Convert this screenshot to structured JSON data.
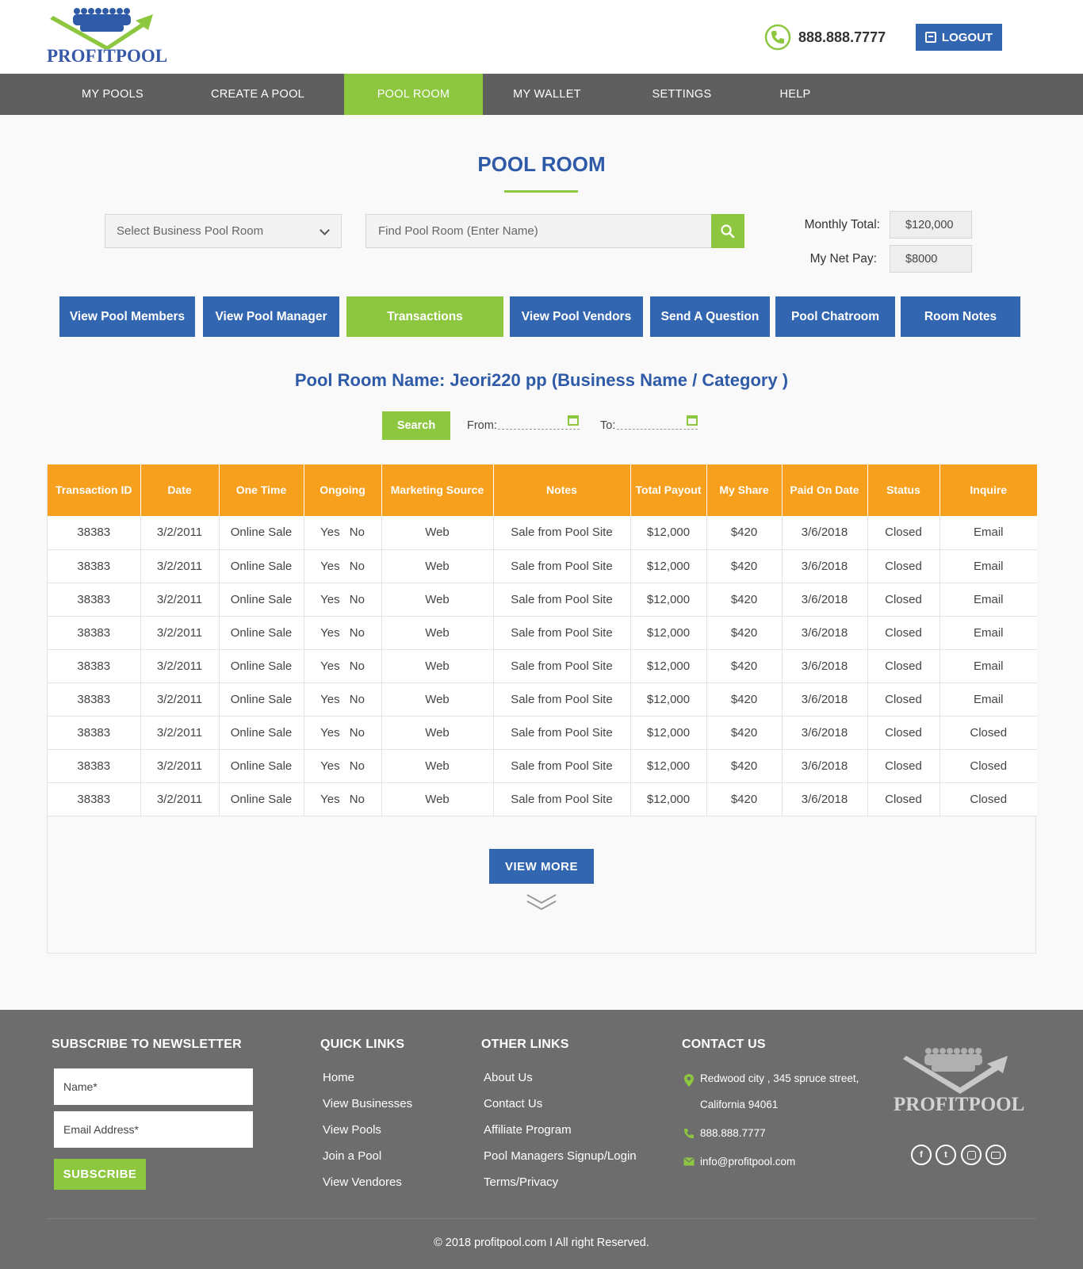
{
  "header": {
    "logo_text": "PROFITPOOL",
    "phone": "888.888.7777",
    "logout_label": "LOGOUT"
  },
  "nav": {
    "items": [
      {
        "label": "MY POOLS"
      },
      {
        "label": "CREATE A POOL"
      },
      {
        "label": "POOL ROOM"
      },
      {
        "label": "MY WALLET"
      },
      {
        "label": "SETTINGS"
      },
      {
        "label": "HELP"
      }
    ],
    "active": "POOL ROOM"
  },
  "page": {
    "title": "POOL ROOM",
    "select_placeholder": "Select Business Pool Room",
    "search_placeholder": "Find Pool Room (Enter Name)",
    "monthly_total_label": "Monthly Total:",
    "monthly_total_value": "$120,000",
    "net_pay_label": "My Net Pay:",
    "net_pay_value": "$8000"
  },
  "tabs": [
    {
      "label": "View Pool Members"
    },
    {
      "label": "View Pool Manager"
    },
    {
      "label": "Transactions"
    },
    {
      "label": "View Pool Vendors"
    },
    {
      "label": "Send A Question"
    },
    {
      "label": "Pool Chatroom"
    },
    {
      "label": "Room Notes"
    }
  ],
  "active_tab": "Transactions",
  "filter": {
    "room_name": "Pool Room Name: Jeori220 pp (Business Name / Category )",
    "search_label": "Search",
    "from_label": "From:",
    "to_label": "To:"
  },
  "table": {
    "headers": [
      "Transaction ID",
      "Date",
      "One Time",
      "Ongoing",
      "Marketing Source",
      "Notes",
      "Total Payout",
      "My Share",
      "Paid On Date",
      "Status",
      "Inquire"
    ],
    "rows": [
      [
        "38383",
        "3/2/2011",
        "Online Sale",
        "Yes No",
        "Web",
        "Sale from Pool Site",
        "$12,000",
        "$420",
        "3/6/2018",
        "Closed",
        "Email"
      ],
      [
        "38383",
        "3/2/2011",
        "Online Sale",
        "Yes No",
        "Web",
        "Sale from Pool Site",
        "$12,000",
        "$420",
        "3/6/2018",
        "Closed",
        "Email"
      ],
      [
        "38383",
        "3/2/2011",
        "Online Sale",
        "Yes No",
        "Web",
        "Sale from Pool Site",
        "$12,000",
        "$420",
        "3/6/2018",
        "Closed",
        "Email"
      ],
      [
        "38383",
        "3/2/2011",
        "Online Sale",
        "Yes No",
        "Web",
        "Sale from Pool Site",
        "$12,000",
        "$420",
        "3/6/2018",
        "Closed",
        "Email"
      ],
      [
        "38383",
        "3/2/2011",
        "Online Sale",
        "Yes No",
        "Web",
        "Sale from Pool Site",
        "$12,000",
        "$420",
        "3/6/2018",
        "Closed",
        "Email"
      ],
      [
        "38383",
        "3/2/2011",
        "Online Sale",
        "Yes No",
        "Web",
        "Sale from Pool Site",
        "$12,000",
        "$420",
        "3/6/2018",
        "Closed",
        "Email"
      ],
      [
        "38383",
        "3/2/2011",
        "Online Sale",
        "Yes No",
        "Web",
        "Sale from Pool Site",
        "$12,000",
        "$420",
        "3/6/2018",
        "Closed",
        "Closed"
      ],
      [
        "38383",
        "3/2/2011",
        "Online Sale",
        "Yes No",
        "Web",
        "Sale from Pool Site",
        "$12,000",
        "$420",
        "3/6/2018",
        "Closed",
        "Closed"
      ],
      [
        "38383",
        "3/2/2011",
        "Online Sale",
        "Yes No",
        "Web",
        "Sale from Pool Site",
        "$12,000",
        "$420",
        "3/6/2018",
        "Closed",
        "Closed"
      ]
    ],
    "view_more_label": "VIEW MORE"
  },
  "footer": {
    "newsletter_heading": "SUBSCRIBE TO NEWSLETTER",
    "name_placeholder": "Name*",
    "email_placeholder": "Email Address*",
    "subscribe_label": "SUBSCRIBE",
    "quick_links_heading": "QUICK LINKS",
    "quick_links": [
      "Home",
      "View Businesses",
      "View Pools",
      "Join a Pool",
      "View Vendores"
    ],
    "other_links_heading": "OTHER LINKS",
    "other_links": [
      "About Us",
      "Contact Us",
      "Affiliate Program",
      "Pool Managers Signup/Login",
      "Terms/Privacy"
    ],
    "contact_heading": "CONTACT US",
    "address_line1": "Redwood city , 345 spruce street,",
    "address_line2": "California 94061",
    "phone": "888.888.7777",
    "email": "info@profitpool.com",
    "logo_text": "PROFITPOOL",
    "social_icons": [
      "facebook-icon",
      "twitter-icon",
      "instagram-icon",
      "youtube-icon"
    ],
    "copyright": "© 2018 profitpool.com I All right Reserved."
  },
  "colors": {
    "brand_blue": "#3366b0",
    "brand_green": "#8dc63f",
    "table_header_orange": "#f6a01e",
    "nav_gray": "#5f5f5f",
    "footer_gray": "#6d6d6d"
  }
}
